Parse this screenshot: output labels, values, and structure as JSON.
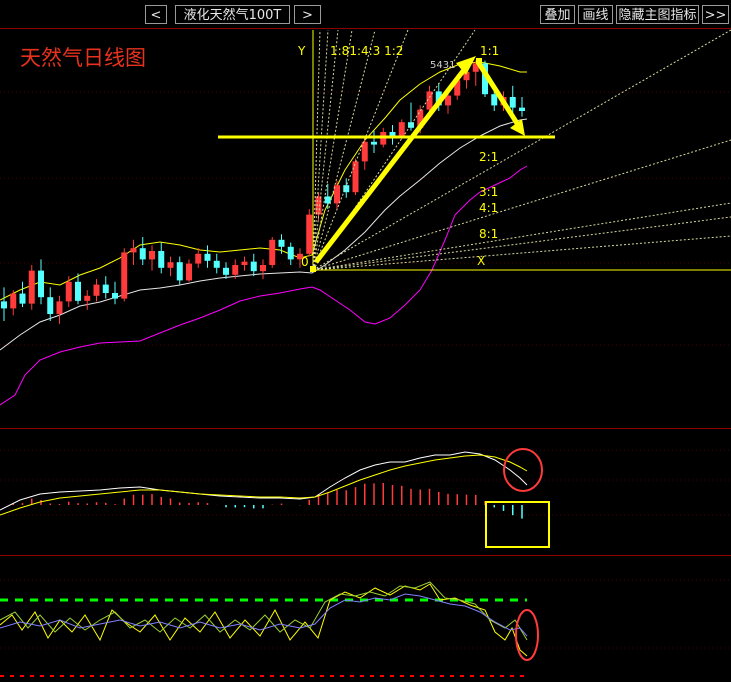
{
  "toolbar": {
    "prev_label": "<",
    "symbol": "液化天然气100T",
    "next_label": ">",
    "overlay_label": "叠加",
    "draw_line_label": "画线",
    "hide_indicator_label": "隐藏主图指标",
    "more_label": ">>"
  },
  "chart_title": "天然气日线图",
  "gann_labels": {
    "y_label": "Y",
    "ratios_top": "1:81:4:3 1:2",
    "r11": "1:1",
    "r21": "2:1",
    "r31": "3:1",
    "r41": "4:1",
    "r81": "8:1",
    "x_label": "X",
    "origin_label": "0"
  },
  "peak_label": "5431",
  "colors": {
    "background": "#000000",
    "up_candle": "#ff3b3b",
    "down_candle": "#54ffff",
    "bollinger_upper": "#ffff00",
    "bollinger_mid": "#ffffff",
    "bollinger_lower": "#ff00ff",
    "annotation": "#ffff00",
    "circle": "#ff3b3b",
    "dash_green": "#00ff00",
    "dash_red": "#ff0000"
  },
  "chart_data": {
    "type": "candlestick",
    "candles": [
      [
        4570,
        4620,
        4500,
        4545
      ],
      [
        4545,
        4610,
        4520,
        4598
      ],
      [
        4598,
        4640,
        4550,
        4562
      ],
      [
        4562,
        4700,
        4540,
        4680
      ],
      [
        4680,
        4720,
        4560,
        4585
      ],
      [
        4585,
        4620,
        4500,
        4525
      ],
      [
        4525,
        4590,
        4490,
        4570
      ],
      [
        4570,
        4660,
        4550,
        4640
      ],
      [
        4640,
        4670,
        4560,
        4572
      ],
      [
        4572,
        4610,
        4540,
        4590
      ],
      [
        4590,
        4650,
        4570,
        4630
      ],
      [
        4630,
        4660,
        4580,
        4600
      ],
      [
        4600,
        4640,
        4560,
        4580
      ],
      [
        4580,
        4760,
        4570,
        4745
      ],
      [
        4745,
        4790,
        4700,
        4760
      ],
      [
        4760,
        4800,
        4700,
        4720
      ],
      [
        4720,
        4770,
        4680,
        4750
      ],
      [
        4750,
        4780,
        4670,
        4690
      ],
      [
        4690,
        4730,
        4660,
        4710
      ],
      [
        4710,
        4730,
        4630,
        4645
      ],
      [
        4645,
        4720,
        4640,
        4705
      ],
      [
        4705,
        4760,
        4690,
        4740
      ],
      [
        4740,
        4770,
        4690,
        4715
      ],
      [
        4715,
        4740,
        4670,
        4690
      ],
      [
        4690,
        4710,
        4650,
        4665
      ],
      [
        4665,
        4720,
        4650,
        4700
      ],
      [
        4700,
        4730,
        4680,
        4712
      ],
      [
        4712,
        4740,
        4660,
        4678
      ],
      [
        4678,
        4720,
        4650,
        4700
      ],
      [
        4700,
        4800,
        4690,
        4790
      ],
      [
        4790,
        4810,
        4740,
        4765
      ],
      [
        4765,
        4780,
        4700,
        4720
      ],
      [
        4720,
        4760,
        4690,
        4740
      ],
      [
        4740,
        4900,
        4730,
        4880
      ],
      [
        4880,
        4960,
        4860,
        4945
      ],
      [
        4945,
        4990,
        4900,
        4920
      ],
      [
        4920,
        5000,
        4900,
        4985
      ],
      [
        4985,
        5010,
        4940,
        4960
      ],
      [
        4960,
        5080,
        4950,
        5070
      ],
      [
        5070,
        5160,
        5040,
        5140
      ],
      [
        5140,
        5180,
        5100,
        5130
      ],
      [
        5130,
        5190,
        5120,
        5175
      ],
      [
        5175,
        5200,
        5130,
        5160
      ],
      [
        5160,
        5220,
        5150,
        5210
      ],
      [
        5210,
        5280,
        5180,
        5190
      ],
      [
        5190,
        5270,
        5170,
        5255
      ],
      [
        5255,
        5340,
        5230,
        5320
      ],
      [
        5320,
        5350,
        5250,
        5270
      ],
      [
        5270,
        5330,
        5240,
        5305
      ],
      [
        5305,
        5380,
        5290,
        5360
      ],
      [
        5360,
        5410,
        5330,
        5390
      ],
      [
        5390,
        5431,
        5340,
        5420
      ],
      [
        5420,
        5430,
        5300,
        5310
      ],
      [
        5310,
        5330,
        5250,
        5270
      ],
      [
        5270,
        5320,
        5250,
        5300
      ],
      [
        5300,
        5340,
        5240,
        5262
      ],
      [
        5262,
        5300,
        5230,
        5250
      ]
    ],
    "annotations": [
      "天然气日线图",
      "5431"
    ],
    "indicators": [
      "Bollinger Bands",
      "MACD",
      "Oscillator"
    ]
  }
}
